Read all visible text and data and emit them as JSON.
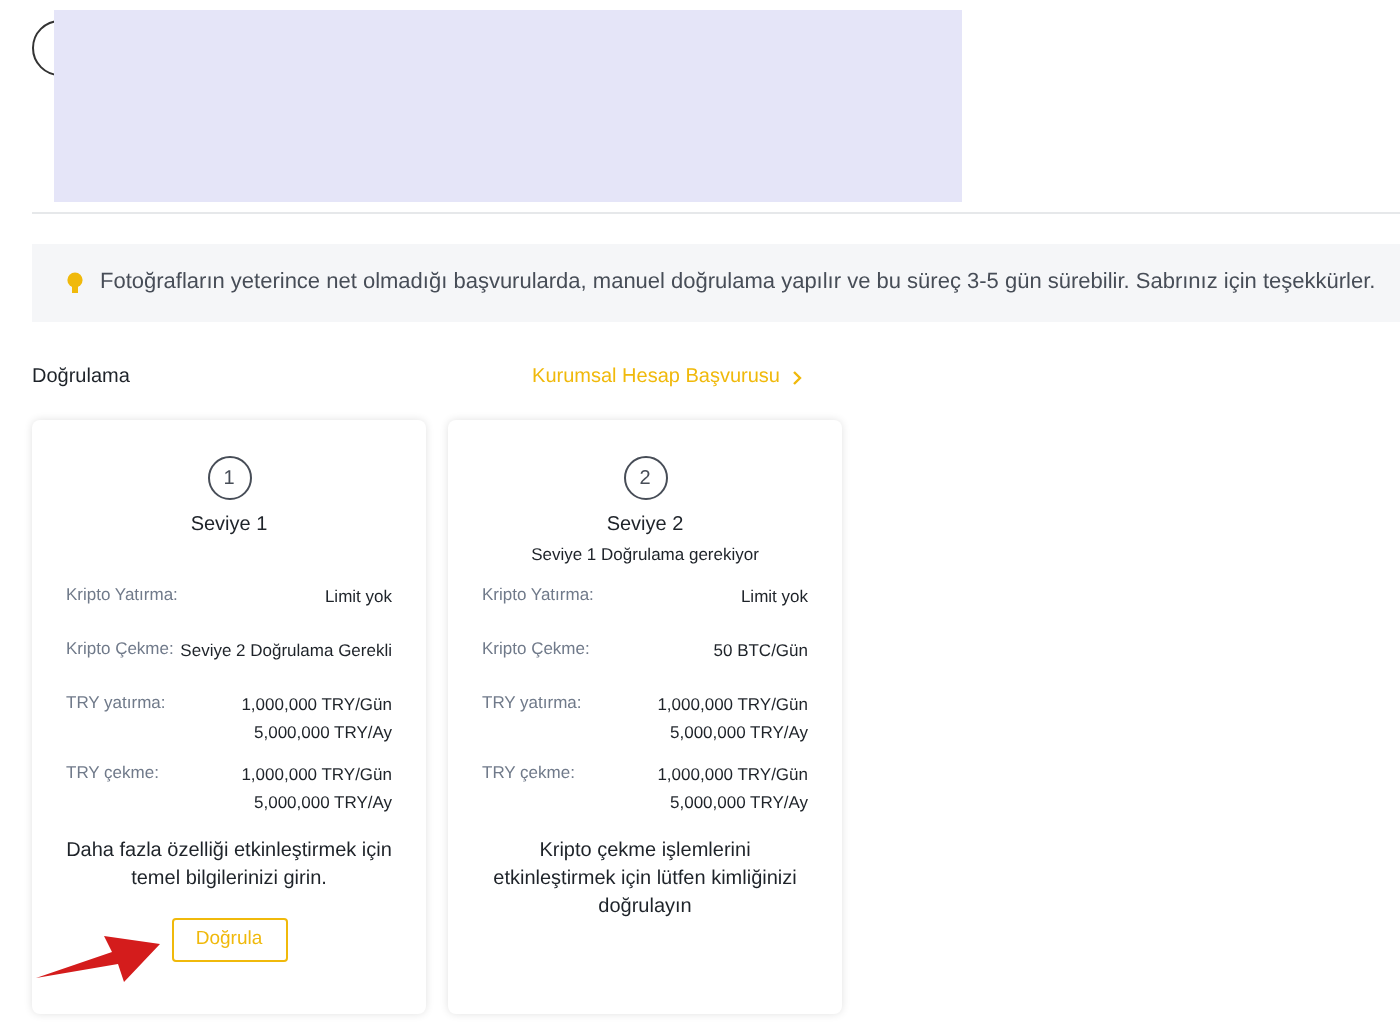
{
  "notice": {
    "text": "Fotoğrafların yeterince net olmadığı başvurularda, manuel doğrulama yapılır ve bu süreç 3-5 gün sürebilir. Sabrınız için teşekkürler."
  },
  "section": {
    "title": "Doğrulama",
    "link": "Kurumsal Hesap Başvurusu"
  },
  "levels": [
    {
      "step": "1",
      "title": "Seviye 1",
      "rows": [
        {
          "label": "Kripto Yatırma:",
          "values": [
            "Limit yok"
          ]
        },
        {
          "label": "Kripto Çekme:",
          "values": [
            "Seviye 2 Doğrulama Gerekli"
          ]
        },
        {
          "label": "TRY yatırma:",
          "values": [
            "1,000,000 TRY/Gün",
            "5,000,000 TRY/Ay"
          ]
        },
        {
          "label": "TRY çekme:",
          "values": [
            "1,000,000 TRY/Gün",
            "5,000,000 TRY/Ay"
          ]
        }
      ],
      "description": "Daha fazla özelliği etkinleştirmek için temel bilgilerinizi girin.",
      "button": "Doğrula"
    },
    {
      "step": "2",
      "title": "Seviye 2",
      "subtitle": "Seviye 1 Doğrulama gerekiyor",
      "rows": [
        {
          "label": "Kripto Yatırma:",
          "values": [
            "Limit yok"
          ]
        },
        {
          "label": "Kripto Çekme:",
          "values": [
            "50 BTC/Gün"
          ]
        },
        {
          "label": "TRY yatırma:",
          "values": [
            "1,000,000 TRY/Gün",
            "5,000,000 TRY/Ay"
          ]
        },
        {
          "label": "TRY çekme:",
          "values": [
            "1,000,000 TRY/Gün",
            "5,000,000 TRY/Ay"
          ]
        }
      ],
      "description": "Kripto çekme işlemlerini etkinleştirmek için lütfen kimliğinizi doğrulayın"
    }
  ]
}
